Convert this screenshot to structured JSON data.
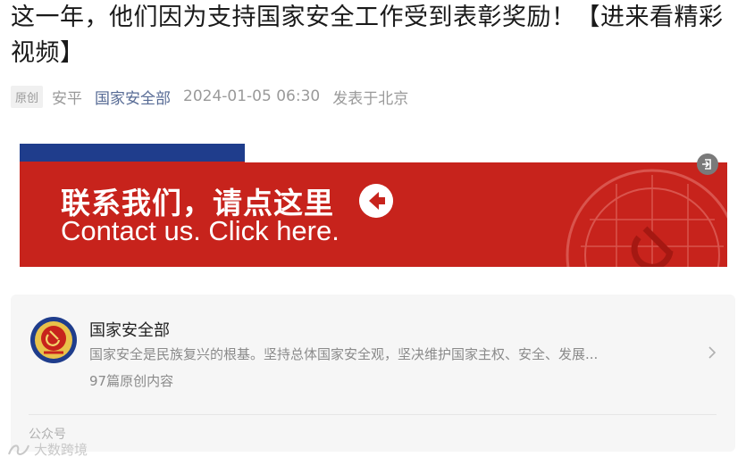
{
  "article": {
    "title": "这一年，他们因为支持国家安全工作受到表彰奖励！【进来看精彩视频】",
    "original_badge": "原创",
    "author": "安平",
    "account_name": "国家安全部",
    "published_time": "2024-01-05 06:30",
    "location": "发表于北京"
  },
  "banner": {
    "text_cn": "联系我们，请点这里",
    "text_en": "Contact us. Click here.",
    "colors": {
      "background": "#c7231c",
      "top_bar": "#1f3d8c"
    }
  },
  "account_card": {
    "name": "国家安全部",
    "description": "国家安全是民族复兴的根基。坚持总体国家安全观，坚决维护国家主权、安全、发展...",
    "article_count": "97篇原创内容",
    "footer_label": "公众号"
  },
  "watermark": {
    "text": "大数跨境"
  },
  "icons": [
    "arrow-left-icon",
    "exit-icon",
    "chevron-right-icon",
    "emblem-icon",
    "watermark-logo-icon"
  ]
}
